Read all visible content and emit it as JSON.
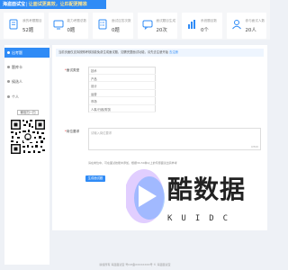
{
  "header": {
    "title": "海盗面试宝",
    "separator": "|",
    "slogan": "让面试更高效，让匹配更精准"
  },
  "stats": [
    {
      "label": "我的考题题目",
      "value": "52题",
      "icon": "document-icon",
      "color": "#2f8bf6"
    },
    {
      "label": "能力考题总数",
      "value": "0题",
      "icon": "monitor-icon",
      "color": "#2f8bf6"
    },
    {
      "label": "面试应答次数",
      "value": "0题",
      "icon": "list-icon",
      "color": "#2f8bf6"
    },
    {
      "label": "面试题目生成",
      "value": "20次",
      "icon": "chat-icon",
      "color": "#2f8bf6"
    },
    {
      "label": "系统题目数",
      "value": "0个",
      "icon": "bar-chart-icon",
      "color": "#2f8bf6"
    },
    {
      "label": "参与面试人数",
      "value": "20人",
      "icon": "user-icon",
      "color": "#2f8bf6"
    }
  ],
  "sidebar": {
    "items": [
      {
        "label": "出考题",
        "icon": "dot-icon",
        "active": true
      },
      {
        "label": "题库卡",
        "icon": "dot-icon"
      },
      {
        "label": "候选人",
        "icon": "dot-icon"
      },
      {
        "label": "个人",
        "icon": "dot-icon"
      }
    ],
    "qr_title": "微信扫一扫"
  },
  "form": {
    "notice": "当前页面仅支持按照考核技能免费生成面试题，如需完整面试功能，请先去注册开始",
    "notice_link": "去注册",
    "category_label": "面试类型",
    "options": [
      "技术",
      "产品",
      "设计",
      "运营",
      "市场",
      "人事/行政/财务"
    ],
    "requirement_label": "岗位要求",
    "requirement_placeholder": "请输入岗位要求",
    "counter": "0/500",
    "hint": "请在岗位中，可在面试技能中添加，根据30-50种以上的专题面试出具参考",
    "submit_label": "生成面试题"
  },
  "watermark": {
    "text": "酷数据",
    "sub": "KUIDC"
  },
  "footer": {
    "text": "版权所有 海盗面试宝   粤ICP备XXXXXXXX号   © 海盗面试宝"
  }
}
